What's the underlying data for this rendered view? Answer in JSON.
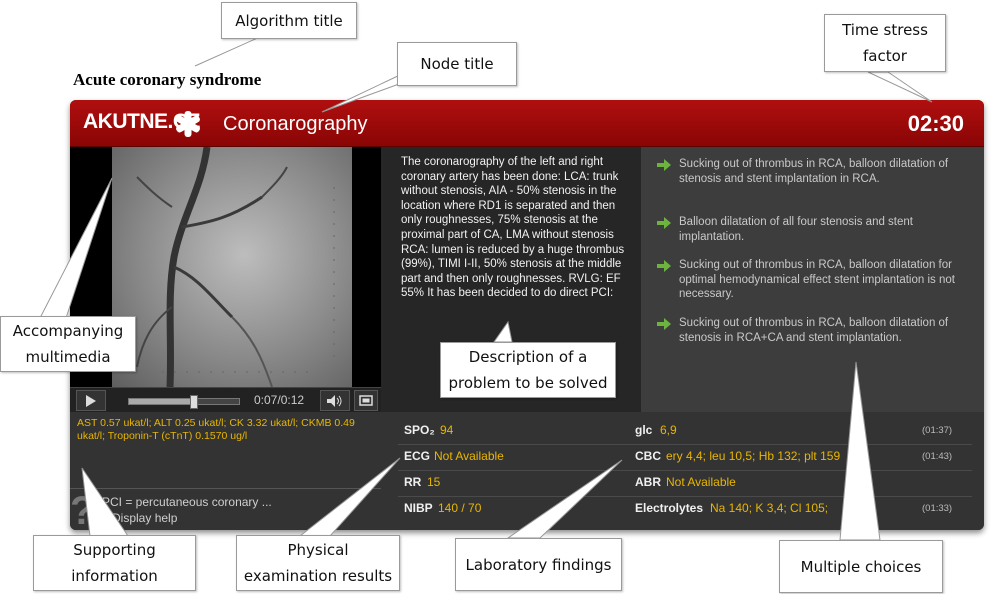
{
  "annotations": {
    "algorithm_title": "Algorithm title",
    "node_title": "Node title",
    "time_stress": [
      "Time stress",
      "factor"
    ],
    "multimedia": [
      "Accompanying",
      "multimedia"
    ],
    "description": [
      "Description of a",
      "problem to be solved"
    ],
    "supporting": [
      "Supporting",
      "information"
    ],
    "physical": [
      "Physical",
      "examination results"
    ],
    "laboratory": "Laboratory findings",
    "choices": "Multiple choices"
  },
  "algorithm": {
    "title": "Acute coronary syndrome"
  },
  "app": {
    "logo": "AKUTNE.CZ",
    "node_title": "Coronarography",
    "timer": "02:30",
    "brand_color": "#9c0a0a"
  },
  "video": {
    "time": "0:07/0:12",
    "progress": 0.58
  },
  "description": "The coronarography of the left and right coronary artery has been done:  LCA: trunk without stenosis, AIA -  50% stenosis in the location where RD1 is separated and then only roughnesses, 75% stenosis at the proximal part of CA, LMA without stenosis  RCA: lumen is reduced by a huge thrombus (99%), TIMI I-II, 50% stenosis at the middle part and then only roughnesses.  RVLG: EF 55% It has been decided to do direct PCI:",
  "choices": [
    "Sucking out of thrombus in RCA, balloon dilatation of stenosis and stent implantation in RCA.",
    "Balloon dilatation of all four stenosis and stent implantation.",
    "Sucking out of thrombus in RCA, balloon dilatation for optimal hemodynamical effect stent implantation is not necessary.",
    "Sucking out of thrombus in RCA, balloon dilatation of stenosis in RCA+CA and stent implantation."
  ],
  "labs_raw": "AST  0.57  ukat/l; ALT 0.25  ukat/l; CK 3.32  ukat/l; CKMB 0.49 ukat/l; Troponin-T (cTnT) 0.1570  ug/l",
  "help": {
    "text": "PCI = percutaneous coronary ...",
    "link": "» Display help"
  },
  "vitals": [
    {
      "label": "SPO₂",
      "value": "94",
      "label2": "glc",
      "value2": "6,9",
      "time": "(01:37)"
    },
    {
      "label": "ECG",
      "value": "Not Available",
      "label2": "CBC",
      "value2": "ery 4,4; leu 10,5; Hb 132; plt 159",
      "time": "(01:43)"
    },
    {
      "label": "RR",
      "value": "15",
      "label2": "ABR",
      "value2": "Not Available",
      "time": ""
    },
    {
      "label": "NIBP",
      "value": "140 / 70",
      "label2": "Electrolytes",
      "value2": "Na 140; K 3,4; Cl 105;",
      "time": "(01:33)"
    }
  ]
}
